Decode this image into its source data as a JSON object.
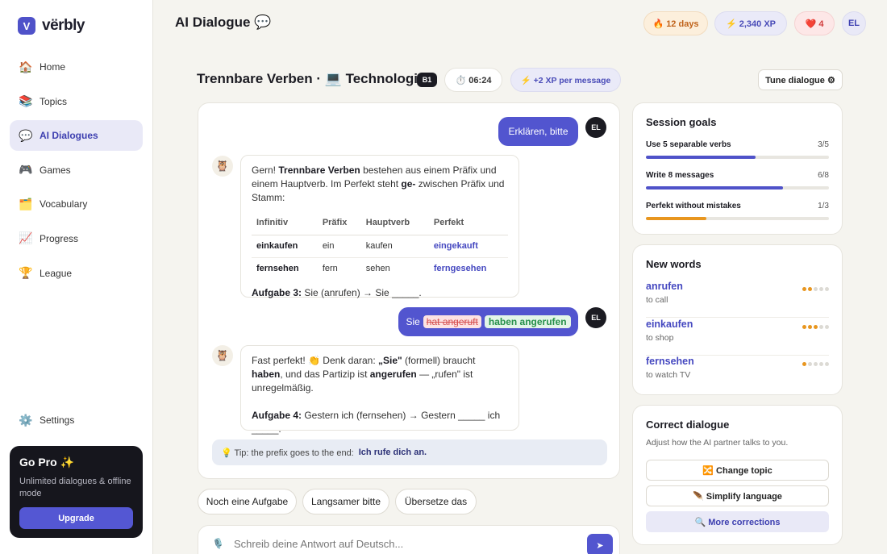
{
  "app": {
    "name": "vërbly",
    "logo_letter": "V"
  },
  "sidebar": {
    "items": [
      {
        "icon": "🏠",
        "label": "Home",
        "active": false
      },
      {
        "icon": "📚",
        "label": "Topics",
        "active": false
      },
      {
        "icon": "💬",
        "label": "AI Dialogues",
        "active": true
      },
      {
        "icon": "🎮",
        "label": "Games",
        "active": false
      },
      {
        "icon": "🗂️",
        "label": "Vocabulary",
        "active": false
      },
      {
        "icon": "📈",
        "label": "Progress",
        "active": false
      },
      {
        "icon": "🏆",
        "label": "League",
        "active": false
      }
    ],
    "settings": {
      "icon": "⚙️",
      "label": "Settings"
    },
    "pro": {
      "title": "Go Pro ✨",
      "desc": "Unlimited dialogues & offline mode",
      "button": "Upgrade"
    }
  },
  "header": {
    "title": "AI Dialogue 💬",
    "streak": "🔥 12 days",
    "xp": "⚡ 2,340 XP",
    "hearts": "❤️ 4",
    "avatar": "EL"
  },
  "dialogue": {
    "title": "Trennbare Verben · 💻 Technologie",
    "level": "B1",
    "timer": "⏱️ 06:24",
    "xp_per_message": "⚡ +2 XP per message",
    "tune_button": "Tune dialogue ⚙"
  },
  "messages": {
    "user1": {
      "text": "Erklären, bitte",
      "avatar": "EL"
    },
    "bot1": {
      "avatar": "🦉",
      "p1": "Gern! ",
      "p1b": "Trennbare Verben",
      "p1c": " bestehen aus einem Präfix und einem Hauptverb. Im Perfekt steht ",
      "p1d": "ge-",
      "p1e": " zwischen Präfix und Stamm:",
      "table": {
        "headers": [
          "Infinitiv",
          "Präfix",
          "Hauptverb",
          "Perfekt"
        ],
        "rows": [
          [
            "einkaufen",
            "ein",
            "kaufen",
            "eingekauft"
          ],
          [
            "fernsehen",
            "fern",
            "sehen",
            "ferngesehen"
          ]
        ]
      },
      "task_label": "Aufgabe 3:",
      "task_text": " Sie (anrufen) → Sie _____."
    },
    "user2": {
      "prefix": "Sie",
      "wrong": "hat angeruft",
      "correct": "haben angerufen",
      "avatar": "EL"
    },
    "bot2": {
      "avatar": "🦉",
      "t1": "Fast perfekt! 👏 Denk daran: ",
      "t1b": "„Sie\"",
      "t1c": " (formell) braucht ",
      "t1d": "haben",
      "t1e": ", und das Partizip ist ",
      "t1f": "angerufen",
      "t1g": " — „rufen\" ist unregelmäßig.",
      "task_label": "Aufgabe 4:",
      "task_text": " Gestern ich (fernsehen) → Gestern _____ ich _____."
    },
    "tip": {
      "text": "💡 Tip: the prefix goes to the end:",
      "example": "Ich rufe dich an."
    }
  },
  "quick_replies": [
    "Noch eine Aufgabe",
    "Langsamer bitte",
    "Übersetze das"
  ],
  "input": {
    "placeholder": "Schreib deine Antwort auf Deutsch...",
    "mic_icon": "🎙️",
    "send_icon": "➤"
  },
  "goals": {
    "title": "Session goals",
    "items": [
      {
        "label": "Use 5 separable verbs",
        "count": "3/5",
        "progress": 0.6,
        "color": "#4f52c9"
      },
      {
        "label": "Write 8 messages",
        "count": "6/8",
        "progress": 0.75,
        "color": "#4f52c9"
      },
      {
        "label": "Perfekt without mistakes",
        "count": "1/3",
        "progress": 0.33,
        "color": "#e8961f"
      }
    ]
  },
  "new_words": {
    "title": "New words",
    "items": [
      {
        "de": "anrufen",
        "en": "to call",
        "level": 2
      },
      {
        "de": "einkaufen",
        "en": "to shop",
        "level": 3
      },
      {
        "de": "fernsehen",
        "en": "to watch TV",
        "level": 1
      }
    ]
  },
  "correct_dialogue": {
    "title": "Correct dialogue",
    "desc": "Adjust how the AI partner talks to you.",
    "buttons": [
      {
        "label": "🔀 Change topic",
        "selected": false
      },
      {
        "label": "🪶 Simplify language",
        "selected": false
      },
      {
        "label": "🔍 More corrections",
        "selected": true
      }
    ]
  }
}
